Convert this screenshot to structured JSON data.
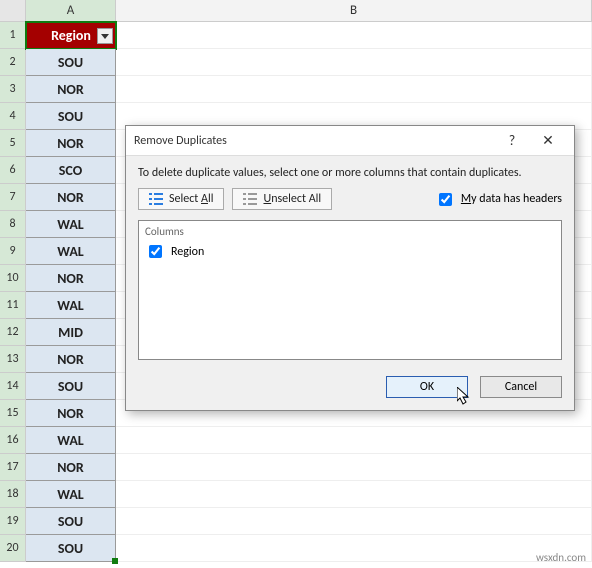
{
  "columns": {
    "A": "A",
    "B": "B"
  },
  "header_cell": "Region",
  "rows": [
    {
      "n": "1",
      "val": "Region",
      "header": true
    },
    {
      "n": "2",
      "val": "SOU"
    },
    {
      "n": "3",
      "val": "NOR"
    },
    {
      "n": "4",
      "val": "SOU"
    },
    {
      "n": "5",
      "val": "NOR"
    },
    {
      "n": "6",
      "val": "SCO"
    },
    {
      "n": "7",
      "val": "NOR"
    },
    {
      "n": "8",
      "val": "WAL"
    },
    {
      "n": "9",
      "val": "WAL"
    },
    {
      "n": "10",
      "val": "NOR"
    },
    {
      "n": "11",
      "val": "WAL"
    },
    {
      "n": "12",
      "val": "MID"
    },
    {
      "n": "13",
      "val": "NOR"
    },
    {
      "n": "14",
      "val": "SOU"
    },
    {
      "n": "15",
      "val": "NOR"
    },
    {
      "n": "16",
      "val": "WAL"
    },
    {
      "n": "17",
      "val": "NOR"
    },
    {
      "n": "18",
      "val": "WAL"
    },
    {
      "n": "19",
      "val": "SOU"
    },
    {
      "n": "20",
      "val": "SOU"
    }
  ],
  "dialog": {
    "title": "Remove Duplicates",
    "help_symbol": "?",
    "close_symbol": "✕",
    "description": "To delete duplicate values, select one or more columns that contain duplicates.",
    "select_all": {
      "pre": "Select ",
      "key": "A",
      "post": "ll"
    },
    "unselect_all": {
      "pre": "",
      "key": "U",
      "post": "nselect All"
    },
    "headers_chk": {
      "pre": "",
      "key": "M",
      "post": "y data has headers",
      "checked": true
    },
    "columns_header": "Columns",
    "column_items": [
      {
        "label": "Region",
        "checked": true
      }
    ],
    "ok": "OK",
    "cancel": "Cancel"
  },
  "watermark": "wsxdn.com"
}
